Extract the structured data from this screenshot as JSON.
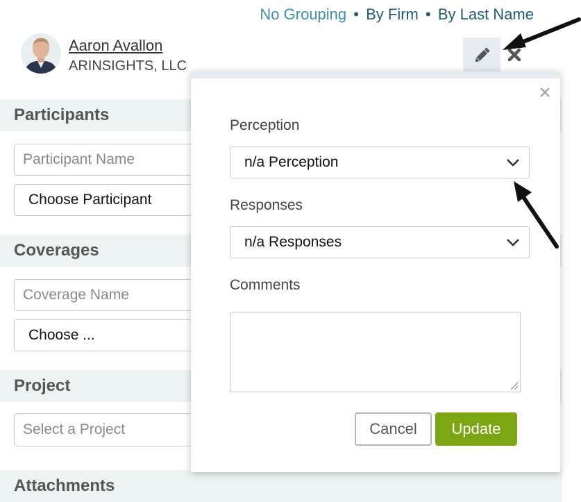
{
  "grouping": {
    "options": [
      "No Grouping",
      "By Firm",
      "By Last Name"
    ],
    "separator": "•"
  },
  "user": {
    "name": "Aaron Avallon",
    "firm": "ARINSIGHTS, LLC"
  },
  "toolbar": {
    "edit_icon": "pencil-icon",
    "remove_icon": "close-icon"
  },
  "sections": {
    "participants": {
      "title": "Participants",
      "name_placeholder": "Participant Name",
      "choose_label": "Choose Participant"
    },
    "coverages": {
      "title": "Coverages",
      "name_placeholder": "Coverage Name",
      "choose_label": "Choose ..."
    },
    "project": {
      "title": "Project",
      "select_placeholder": "Select a Project"
    },
    "attachments": {
      "title": "Attachments"
    }
  },
  "modal": {
    "perception_label": "Perception",
    "perception_value": "n/a Perception",
    "responses_label": "Responses",
    "responses_value": "n/a Responses",
    "comments_label": "Comments",
    "comments_value": "",
    "cancel_label": "Cancel",
    "update_label": "Update"
  },
  "colors": {
    "link": "#1e5a7a",
    "link_active": "#3a8fb3",
    "section_bg": "#edf2f3",
    "update_button": "#7ca610"
  }
}
